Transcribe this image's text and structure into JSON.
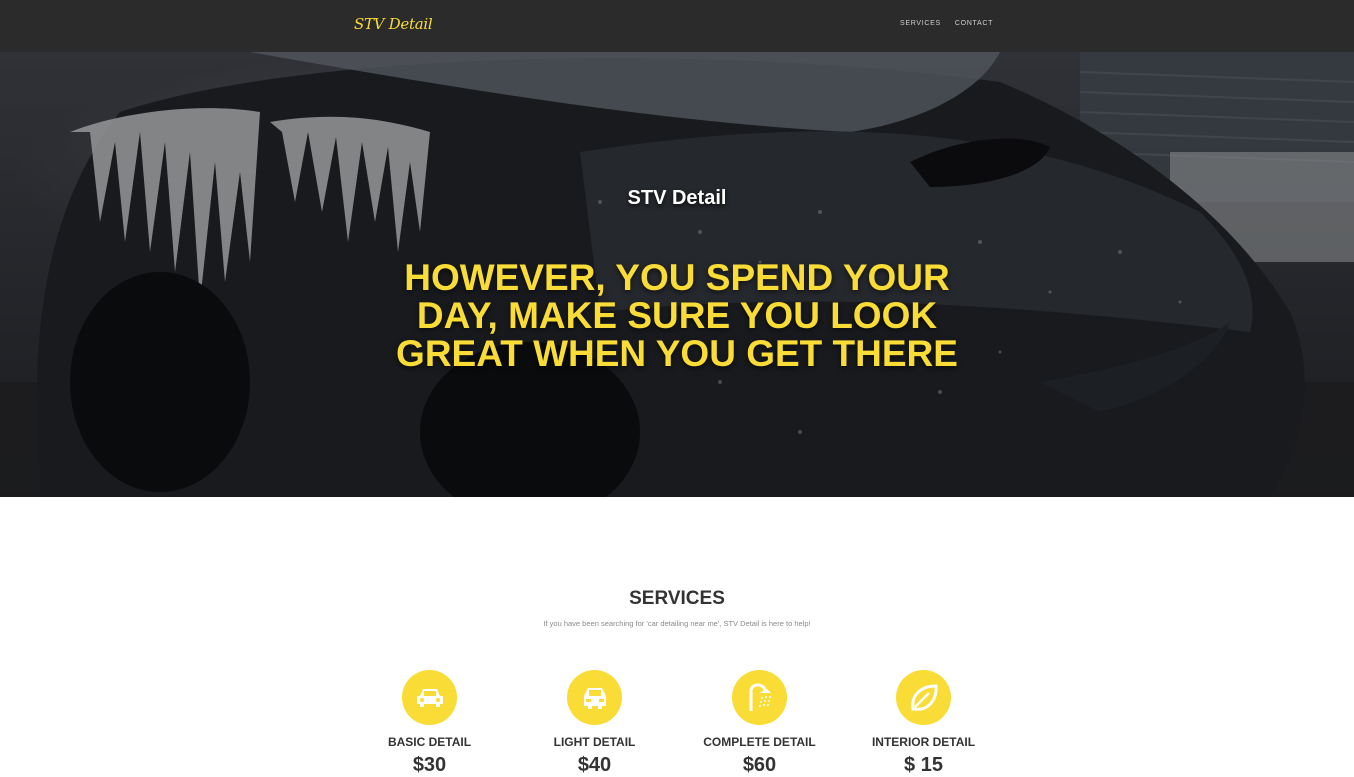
{
  "navbar": {
    "brand": "STV Detail",
    "links": [
      "SERVICES",
      "CONTACT"
    ]
  },
  "hero": {
    "title": "STV Detail",
    "headline": "HOWEVER, YOU SPEND YOUR DAY, MAKE SURE YOU LOOK GREAT WHEN YOU GET THERE"
  },
  "services": {
    "title": "SERVICES",
    "subtitle": "If you have been searching for 'car detailing near me', STV Detail is here to help!",
    "items": [
      {
        "icon": "car-icon",
        "name": "BASIC DETAIL",
        "price": "$30"
      },
      {
        "icon": "car-front-icon",
        "name": "LIGHT DETAIL",
        "price": "$40"
      },
      {
        "icon": "shower-icon",
        "name": "COMPLETE DETAIL",
        "price": "$60"
      },
      {
        "icon": "leaf-icon",
        "name": "INTERIOR DETAIL",
        "price": "$ 15"
      }
    ]
  },
  "colors": {
    "accent": "#f9dc35",
    "navbar_bg": "#2b2b2b"
  }
}
